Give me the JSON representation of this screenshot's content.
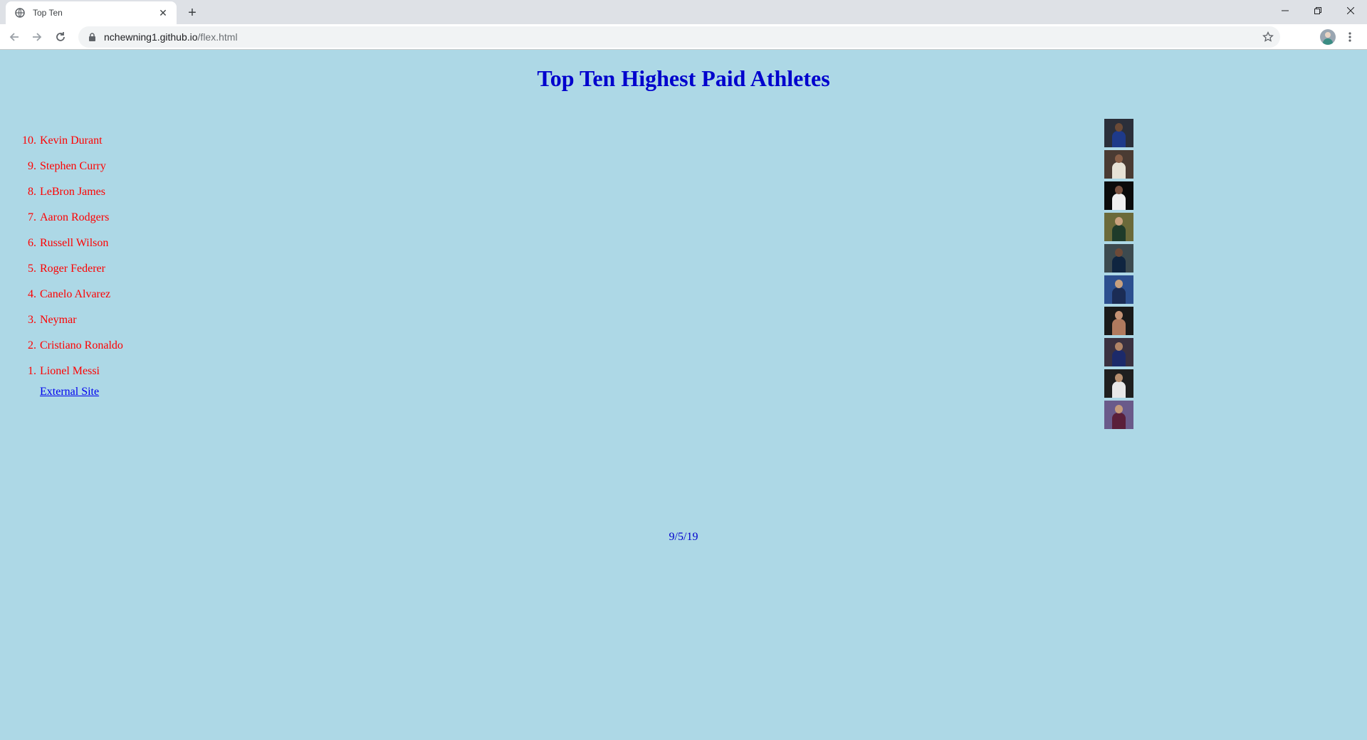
{
  "browser": {
    "tab_title": "Top Ten",
    "new_tab_label": "+",
    "url_host": "nchewning1.github.io",
    "url_path": "/flex.html"
  },
  "page": {
    "title": "Top Ten Highest Paid Athletes",
    "athletes": [
      {
        "rank": "10.",
        "name": "Kevin Durant"
      },
      {
        "rank": "9.",
        "name": "Stephen Curry"
      },
      {
        "rank": "8.",
        "name": "LeBron James"
      },
      {
        "rank": "7.",
        "name": "Aaron Rodgers"
      },
      {
        "rank": "6.",
        "name": "Russell Wilson"
      },
      {
        "rank": "5.",
        "name": "Roger Federer"
      },
      {
        "rank": "4.",
        "name": "Canelo Alvarez"
      },
      {
        "rank": "3.",
        "name": "Neymar"
      },
      {
        "rank": "2.",
        "name": "Cristiano Ronaldo"
      },
      {
        "rank": "1.",
        "name": "Lionel Messi"
      }
    ],
    "external_link": "External Site",
    "date": "9/5/19"
  },
  "colors": {
    "background": "#add8e6",
    "title": "#0000cd",
    "list_text": "#ff0000",
    "link": "#0000ee"
  },
  "photos": [
    {
      "bg": "#2b2f3a",
      "skin": "#6b4a36",
      "shirt": "#1e3a8a"
    },
    {
      "bg": "#4a3b33",
      "skin": "#8a6048",
      "shirt": "#e7e2d6"
    },
    {
      "bg": "#0b0b0b",
      "skin": "#7a5240",
      "shirt": "#f0f0f0"
    },
    {
      "bg": "#6b6a3a",
      "skin": "#caa27e",
      "shirt": "#1f3b2a"
    },
    {
      "bg": "#3c4a4f",
      "skin": "#6d4a38",
      "shirt": "#0f2540"
    },
    {
      "bg": "#2c4f8f",
      "skin": "#c8a07e",
      "shirt": "#1b2c55"
    },
    {
      "bg": "#1a1a1a",
      "skin": "#c49274",
      "shirt": "#b07a5e"
    },
    {
      "bg": "#3a3140",
      "skin": "#b08466",
      "shirt": "#1c2a6a"
    },
    {
      "bg": "#1f1f1f",
      "skin": "#b88f6e",
      "shirt": "#e8e8e8"
    },
    {
      "bg": "#6a5a8a",
      "skin": "#c79b7a",
      "shirt": "#5a1f3a"
    }
  ]
}
